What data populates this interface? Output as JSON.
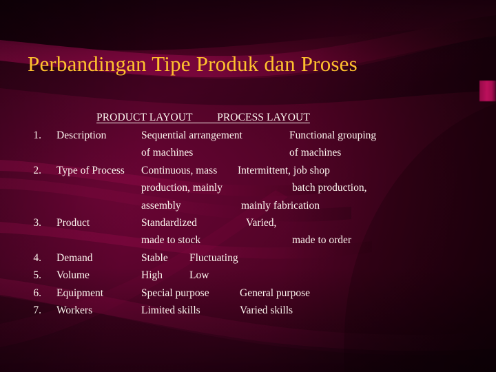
{
  "slide": {
    "title": "Perbandingan Tipe Produk dan Proses",
    "title_color": "#ffc22e",
    "body_color": "#fdf6ef",
    "background_color": "#5a042c"
  },
  "table": {
    "headers": {
      "col2": "PRODUCT LAYOUT",
      "col3": "PROCESS LAYOUT",
      "underlined_text": "PRODUCT LAYOUT         PROCESS LAYOUT"
    },
    "rows": [
      {
        "number": "1.",
        "label": "Description",
        "product_layout": [
          "Sequential arrangement",
          "of machines"
        ],
        "process_layout": [
          "Functional grouping",
          "of machines"
        ]
      },
      {
        "number": "2.",
        "label": "Type of Process",
        "product_layout": [
          "Continuous, mass",
          "production, mainly",
          "assembly"
        ],
        "process_layout": [
          "Intermittent, job shop",
          "batch production,",
          "mainly fabrication"
        ]
      },
      {
        "number": "3.",
        "label": "Product",
        "product_layout": [
          "Standardized",
          "made to stock"
        ],
        "process_layout": [
          "Varied,",
          "made to order"
        ]
      },
      {
        "number": "4.",
        "label": "Demand",
        "product_layout": [
          "Stable"
        ],
        "process_layout": [
          "Fluctuating"
        ]
      },
      {
        "number": "5.",
        "label": "Volume",
        "product_layout": [
          "High"
        ],
        "process_layout": [
          "Low"
        ]
      },
      {
        "number": "6.",
        "label": "Equipment",
        "product_layout": [
          "Special purpose"
        ],
        "process_layout": [
          "General purpose"
        ]
      },
      {
        "number": "7.",
        "label": "Workers",
        "product_layout": [
          "Limited skills"
        ],
        "process_layout": [
          "Varied skills"
        ]
      }
    ]
  }
}
